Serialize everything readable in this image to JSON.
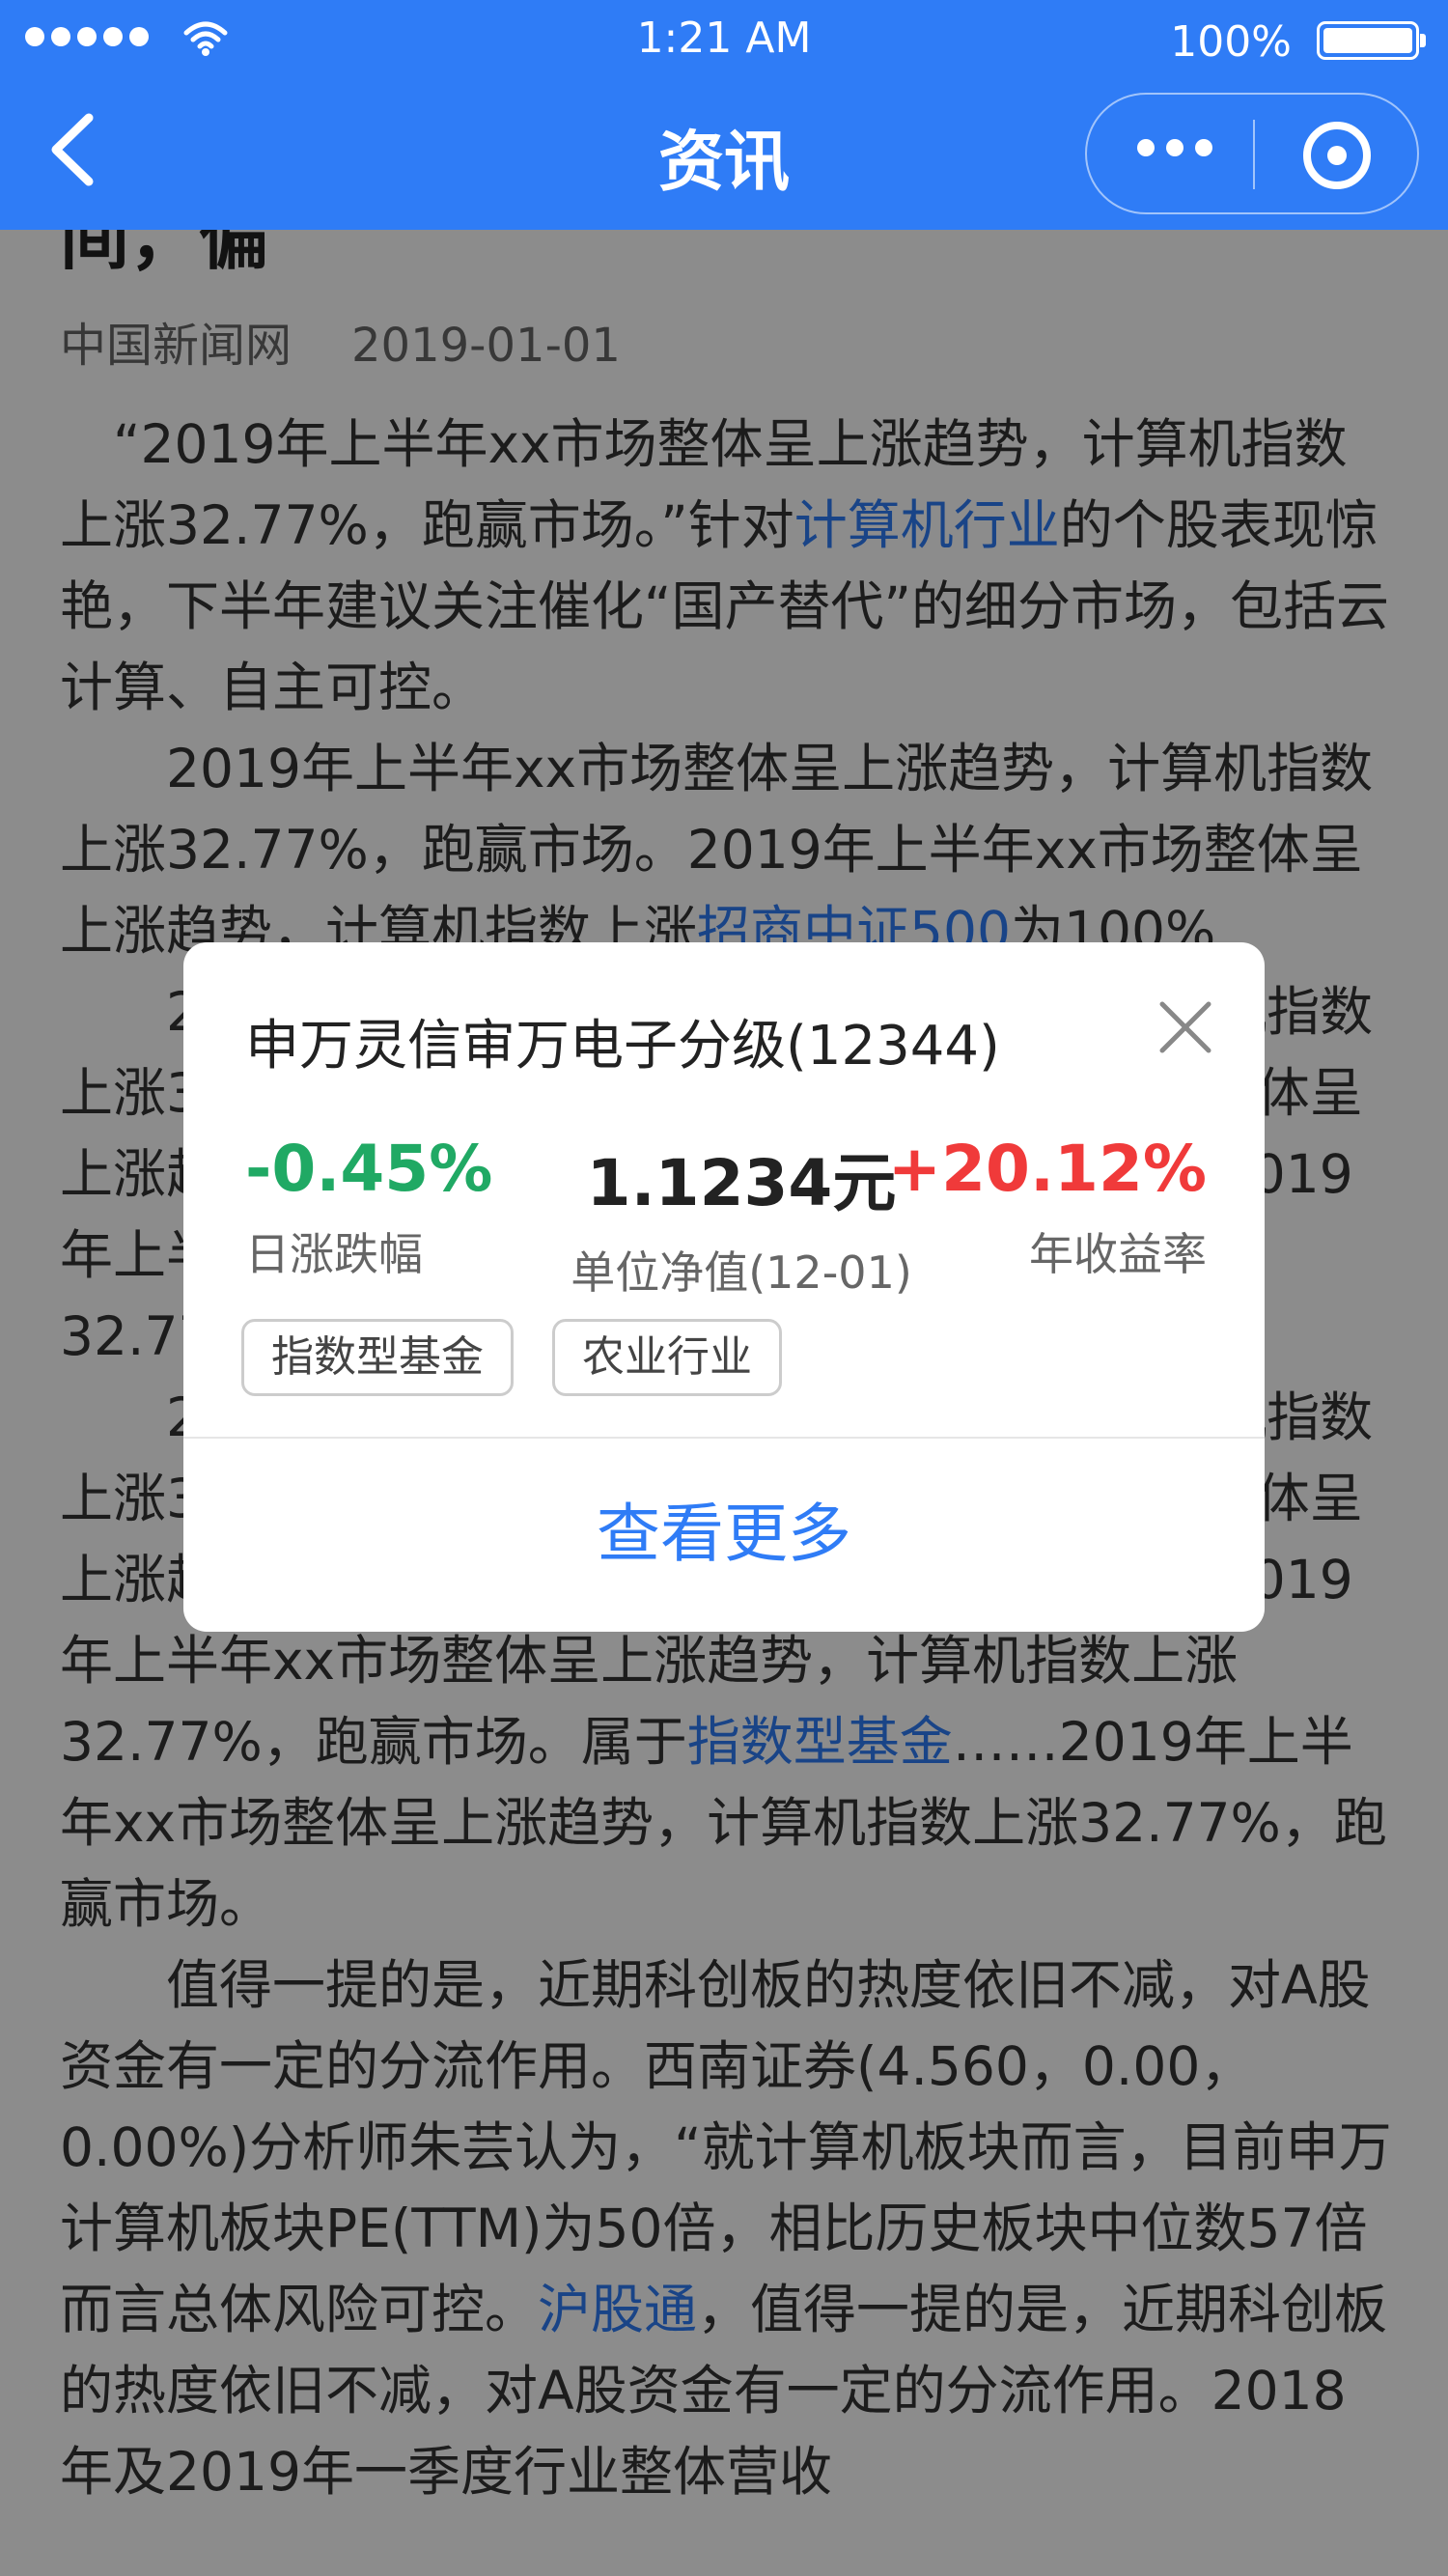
{
  "status_bar": {
    "time": "1:21 AM",
    "battery_text": "100%"
  },
  "nav": {
    "title": "资讯"
  },
  "article": {
    "title_fragment": "间，偏",
    "source": "中国新闻网",
    "date": "2019-01-01",
    "paragraphs": [
      [
        {
          "text": "“2019年上半年xx市场整体呈上涨趋势，计算机指数上涨32.77%，跑赢市场。”针对"
        },
        {
          "text": "计算机行业",
          "link": true
        },
        {
          "text": "的个股表现惊艳，下半年建议关注催化“国产替代”的细分市场，包括云计算、自主可控。"
        }
      ],
      [
        {
          "text": "2019年上半年xx市场整体呈上涨趋势，计算机指数上涨32.77%，跑赢市场。2019年上半年xx市场整体呈上涨趋势，计算机指数上涨"
        },
        {
          "text": "招商中证500",
          "link": true
        },
        {
          "text": "为100%"
        }
      ],
      [
        {
          "text": "2019年上半年xx市场整体呈上涨趋势，计算机指数上涨32.77%，跑赢市场。2019年上半年xx市场整体呈上涨趋势，计算机指数上涨32.77%，跑赢市场。2019年上半年xx市场整体呈上涨趋势，计算机指数上涨32.77%，跑赢市场。"
        }
      ],
      [
        {
          "text": "2019年上半年xx市场整体呈上涨趋势，计算机指数上涨32.77%，跑赢市场。2019年上半年xx市场整体呈上涨趋势，计算机指数上涨32.77%，跑赢市场。2019年上半年xx市场整体呈上涨趋势，计算机指数上涨32.77%，跑赢市场。属于"
        },
        {
          "text": "指数型基金",
          "link": true
        },
        {
          "text": "……2019年上半年xx市场整体呈上涨趋势，计算机指数上涨32.77%，跑赢市场。"
        }
      ],
      [
        {
          "text": "值得一提的是，近期科创板的热度依旧不减，对A股资金有一定的分流作用。西南证券(4.560，0.00，0.00%)分析师朱芸认为，“就计算机板块而言，目前申万计算机板块PE(TTM)为50倍，相比历史板块中位数57倍而言总体风险可控。"
        },
        {
          "text": "沪股通",
          "link": true
        },
        {
          "text": "，值得一提的是，近期科创板的热度依旧不减，对A股资金有一定的分流作用。2018年及2019年一季度行业整体营收"
        }
      ]
    ]
  },
  "modal": {
    "title": "申万灵信审万电子分级(12344)",
    "daily_change": {
      "value": "-0.45%",
      "label": "日涨跌幅"
    },
    "unit_nav": {
      "value": "1.1234元",
      "label": "单位净值(12-01)"
    },
    "annual_return": {
      "value": "+20.12%",
      "label": "年收益率"
    },
    "tags": [
      "指数型基金",
      "农业行业"
    ],
    "view_more": "查看更多"
  },
  "colors": {
    "brand": "#2f7cf6",
    "positive": "#f03a3a",
    "negative": "#20a964"
  }
}
